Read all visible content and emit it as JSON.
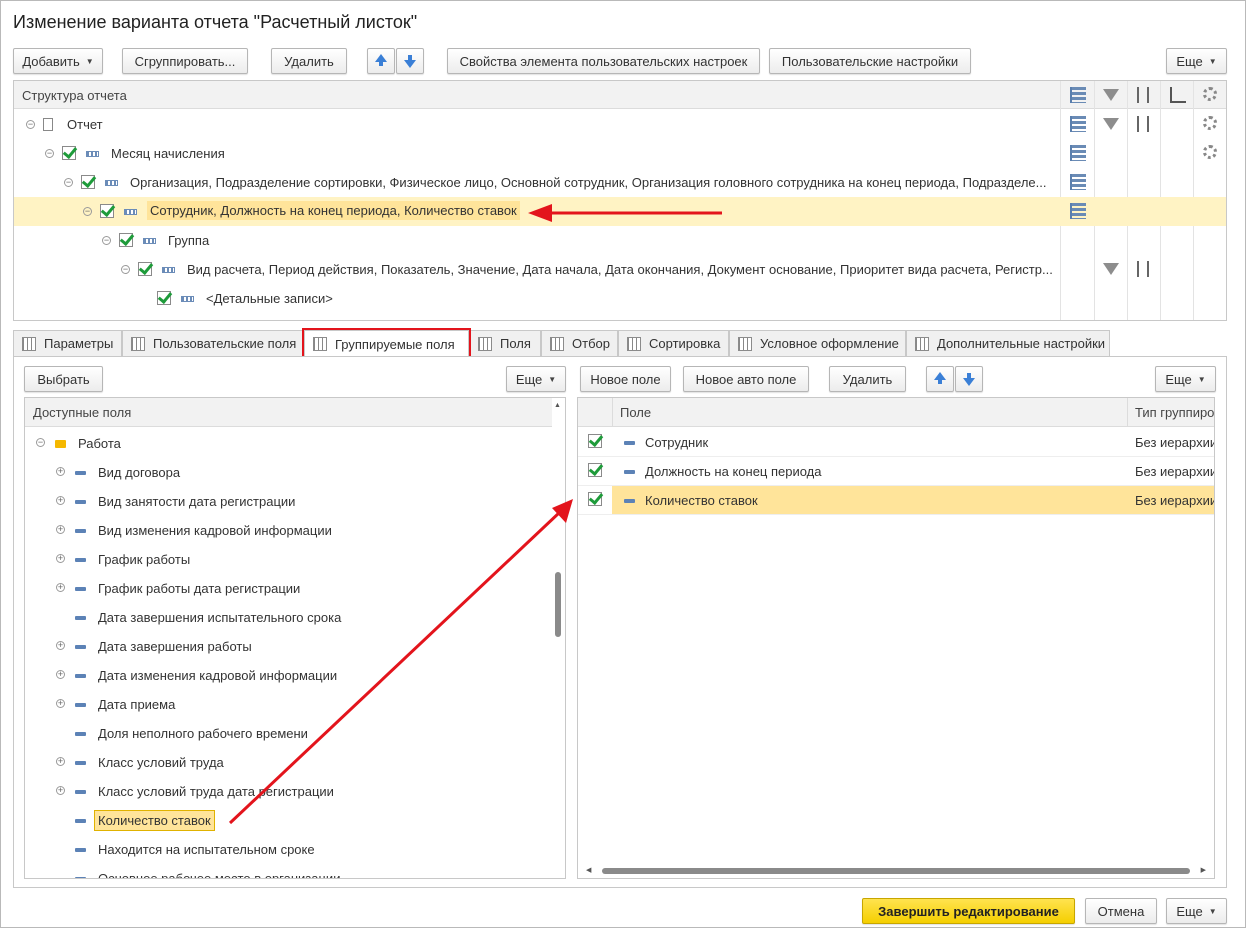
{
  "window": {
    "title": "Изменение варианта отчета \"Расчетный листок\""
  },
  "toolbar": {
    "add": "Добавить",
    "group": "Сгруппировать...",
    "delete": "Удалить",
    "element_props": "Свойства элемента пользовательских настроек",
    "user_settings": "Пользовательские настройки",
    "more": "Еще"
  },
  "structure": {
    "header": "Структура отчета",
    "rows": [
      {
        "label": "Отчет"
      },
      {
        "label": "Месяц начисления"
      },
      {
        "label": "Организация, Подразделение сортировки, Физическое лицо, Основной сотрудник, Организация головного сотрудника на конец периода, Подразделе..."
      },
      {
        "label": "Сотрудник, Должность на конец периода, Количество ставок"
      },
      {
        "label": "Группа"
      },
      {
        "label": "Вид расчета, Период действия, Показатель, Значение, Дата начала, Дата окончания, Документ основание, Приоритет вида расчета, Регистр..."
      },
      {
        "label": "<Детальные записи>"
      }
    ]
  },
  "tabs": [
    {
      "label": "Параметры"
    },
    {
      "label": "Пользовательские поля"
    },
    {
      "label": "Группируемые поля"
    },
    {
      "label": "Поля"
    },
    {
      "label": "Отбор"
    },
    {
      "label": "Сортировка"
    },
    {
      "label": "Условное оформление"
    },
    {
      "label": "Дополнительные настройки"
    }
  ],
  "left_pane": {
    "select": "Выбрать",
    "more": "Еще",
    "header": "Доступные поля",
    "folder": "Работа",
    "items": [
      {
        "label": "Вид договора"
      },
      {
        "label": "Вид занятости дата регистрации"
      },
      {
        "label": "Вид изменения кадровой информации"
      },
      {
        "label": "График работы"
      },
      {
        "label": "График работы дата регистрации"
      },
      {
        "label": "Дата завершения испытательного срока"
      },
      {
        "label": "Дата завершения работы"
      },
      {
        "label": "Дата изменения кадровой информации"
      },
      {
        "label": "Дата приема"
      },
      {
        "label": "Доля неполного рабочего времени"
      },
      {
        "label": "Класс условий труда"
      },
      {
        "label": "Класс условий труда дата регистрации"
      },
      {
        "label": "Количество ставок"
      },
      {
        "label": "Находится на испытательном сроке"
      },
      {
        "label": "Основное рабочее место в организации"
      }
    ]
  },
  "right_pane": {
    "new_field": "Новое поле",
    "new_auto_field": "Новое авто поле",
    "delete": "Удалить",
    "more": "Еще",
    "col_field": "Поле",
    "col_type": "Тип группиро",
    "rows": [
      {
        "field": "Сотрудник",
        "type": "Без иерархии"
      },
      {
        "field": "Должность на конец периода",
        "type": "Без иерархии"
      },
      {
        "field": "Количество ставок",
        "type": "Без иерархии"
      }
    ]
  },
  "footer": {
    "finish": "Завершить редактирование",
    "cancel": "Отмена",
    "more": "Еще"
  },
  "colors": {
    "accent_yellow": "#f5cf00",
    "highlight_row": "#ffe49a",
    "annotation_red": "#e3141c",
    "check_green": "#1e9b3a"
  }
}
